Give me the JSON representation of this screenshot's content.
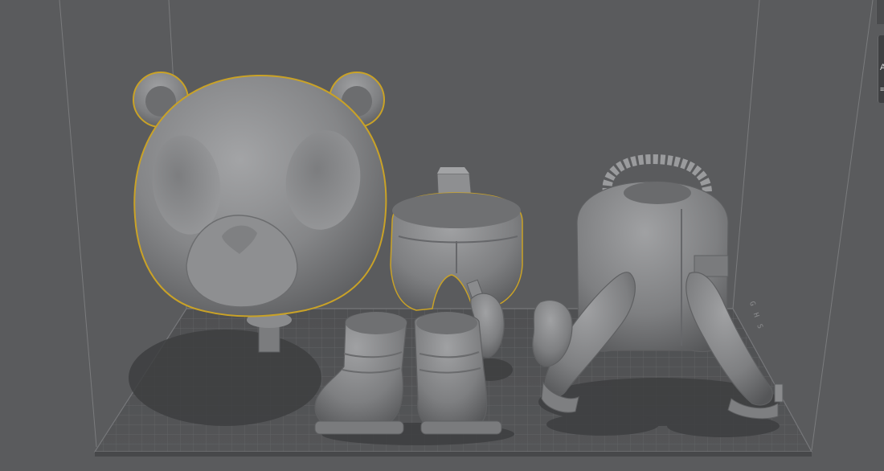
{
  "scene": {
    "background": "#5a5b5d",
    "plate_color": "#505153",
    "grid_color": "#6e6f71",
    "model_color": "#8a8b8d",
    "highlight_color": "#c9a227",
    "objects": [
      {
        "name": "bear-head",
        "highlighted_edges": true
      },
      {
        "name": "torso-shorts",
        "highlighted_edges": true
      },
      {
        "name": "left-boot",
        "highlighted_edges": false
      },
      {
        "name": "right-boot",
        "highlighted_edges": false
      },
      {
        "name": "small-hand",
        "highlighted_edges": false
      },
      {
        "name": "jacket-arms",
        "highlighted_edges": false
      }
    ]
  },
  "side_panel": {
    "glyph_a": "A",
    "glyph_b": "≡"
  },
  "plate_mark": "G H S"
}
